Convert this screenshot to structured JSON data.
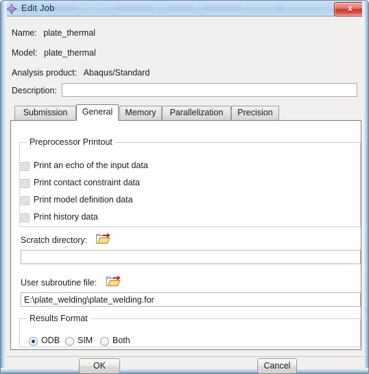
{
  "window": {
    "title": "Edit Job",
    "icon": "abaqus-diamond-icon",
    "close_label": "x",
    "accent_blue": "#b3d0ea",
    "close_red": "#c33a2e"
  },
  "info": {
    "name_label": "Name:",
    "name_value": "plate_thermal",
    "model_label": "Model:",
    "model_value": "plate_thermal",
    "product_label": "Analysis product:",
    "product_value": "Abaqus/Standard",
    "description_label": "Description:",
    "description_value": "",
    "description_placeholder": ""
  },
  "tabs": [
    {
      "label": "Submission",
      "active": false
    },
    {
      "label": "General",
      "active": true
    },
    {
      "label": "Memory",
      "active": false
    },
    {
      "label": "Parallelization",
      "active": false
    },
    {
      "label": "Precision",
      "active": false
    }
  ],
  "preprocessor": {
    "group_title": "Preprocessor Printout",
    "items": [
      {
        "label": "Print an echo of the input data",
        "checked": false
      },
      {
        "label": "Print contact constraint data",
        "checked": false
      },
      {
        "label": "Print model definition data",
        "checked": false
      },
      {
        "label": "Print history data",
        "checked": false
      }
    ]
  },
  "scratch": {
    "label": "Scratch directory:",
    "browse_icon": "open-folder-icon",
    "value": "",
    "placeholder": ""
  },
  "subroutine": {
    "label": "User subroutine file:",
    "browse_icon": "open-folder-icon",
    "value": "E:\\plate_welding\\plate_welding.for",
    "placeholder": ""
  },
  "results_format": {
    "group_title": "Results Format",
    "options": [
      {
        "label": "ODB",
        "selected": true
      },
      {
        "label": "SIM",
        "selected": false
      },
      {
        "label": "Both",
        "selected": false
      }
    ]
  },
  "footer": {
    "ok_label": "OK",
    "cancel_label": "Cancel"
  }
}
